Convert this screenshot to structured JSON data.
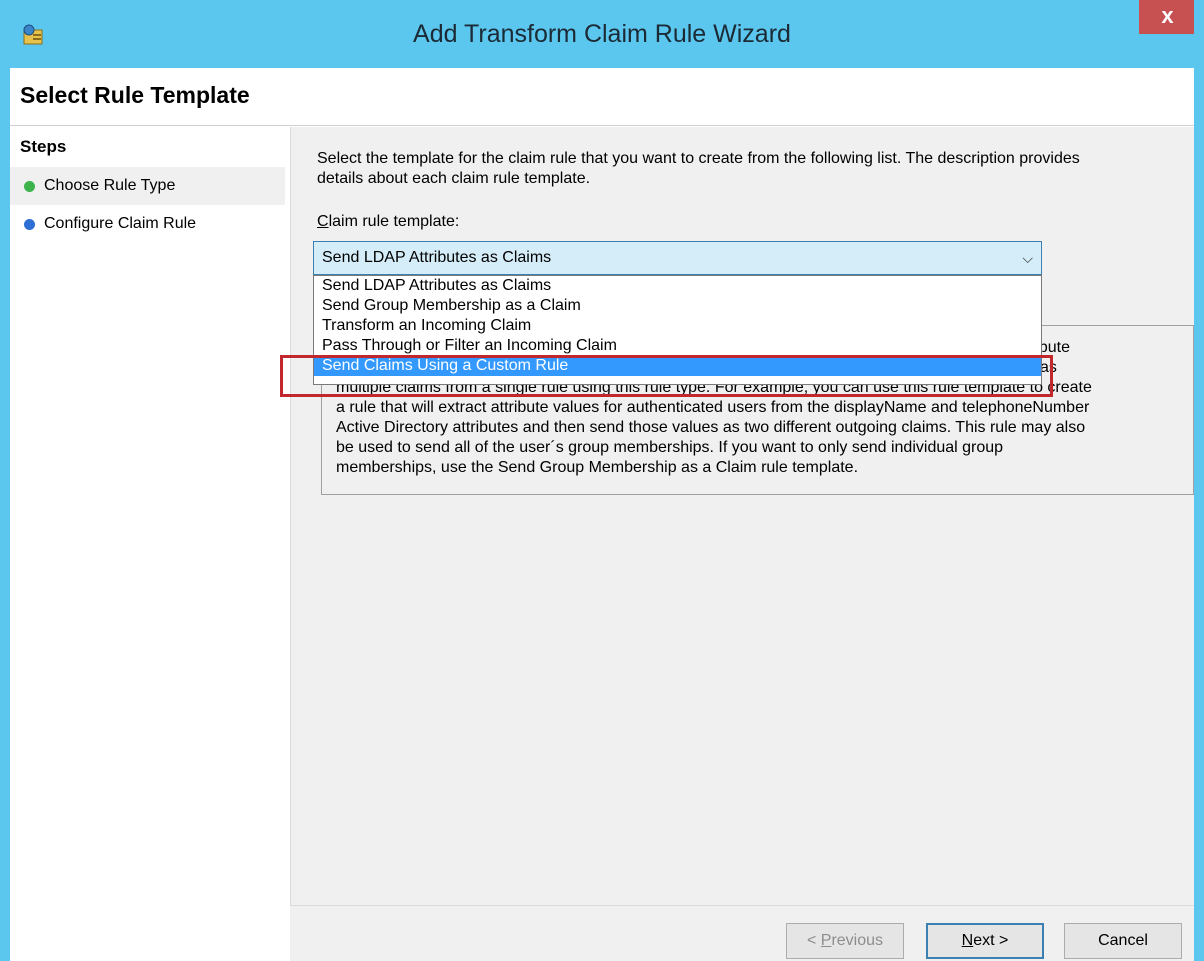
{
  "window": {
    "title": "Add Transform Claim Rule Wizard",
    "close_label": "x"
  },
  "page": {
    "title": "Select Rule Template"
  },
  "steps": {
    "heading": "Steps",
    "items": [
      {
        "label": "Choose Rule Type",
        "status": "current",
        "dot_color": "#3cb44b"
      },
      {
        "label": "Configure Claim Rule",
        "status": "pending",
        "dot_color": "#2e6fd6"
      }
    ]
  },
  "main": {
    "intro_line1": "Select the template for the claim rule that you want to create from the following list. The description provides",
    "intro_line2": "details about each claim rule template.",
    "field_label_mnemonic": "C",
    "field_label_rest": "laim rule template:",
    "selected_value": "Send LDAP Attributes as Claims",
    "dropdown_options": [
      "Send LDAP Attributes as Claims",
      "Send Group Membership as a Claim",
      "Transform an Incoming Claim",
      "Pass Through or Filter an Incoming Claim",
      "Send Claims Using a Custom Rule"
    ],
    "highlighted_option": "Send Claims Using a Custom Rule",
    "description_lines": [
      "Using the Send LDAP Attribute as Claims rule template you can select attributes from an LDAP attribute",
      "store such as Active Directory to send as claims to the relying party. Multiple attributes may be sent as",
      "multiple claims from a single rule using this rule type. For example, you can use this rule template to create",
      "a rule that will extract attribute values for authenticated users from the displayName and telephoneNumber",
      "Active Directory attributes and then send those values as two different outgoing claims. This rule may also",
      "be used to send all of the user´s group memberships. If you want to only send individual group",
      "memberships, use the Send Group Membership as a Claim rule template."
    ]
  },
  "footer": {
    "previous_mnemonic": "P",
    "previous_rest": "revious",
    "previous_prefix": "< ",
    "next_mnemonic": "N",
    "next_rest": "ext >",
    "cancel_label": "Cancel"
  },
  "colors": {
    "title_bar": "#5bc6ee",
    "accent": "#3399ff",
    "annotation": "#c0282d"
  }
}
